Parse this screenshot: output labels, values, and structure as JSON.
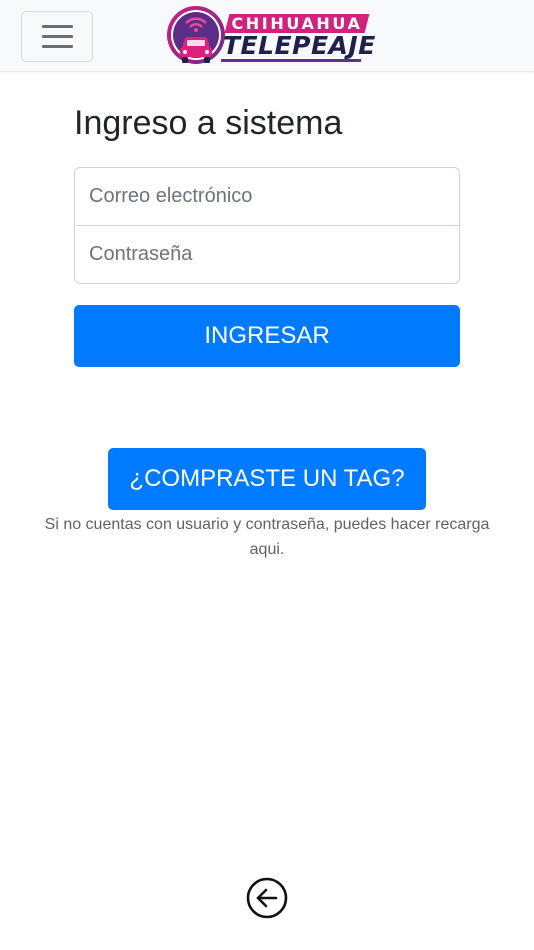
{
  "logo": {
    "line1": "CHIHUAHUA",
    "line2": "TELEPEAJE"
  },
  "login": {
    "title": "Ingreso a sistema",
    "email_placeholder": "Correo electrónico",
    "password_placeholder": "Contraseña",
    "submit_label": "INGRESAR"
  },
  "tag": {
    "button_label": "¿COMPRASTE UN TAG?",
    "help_text": "Si no cuentas con usuario y contraseña, puedes hacer recarga",
    "help_link": "aqui."
  },
  "icons": {
    "menu": "hamburger-icon",
    "back": "arrow-left-circle-icon",
    "logo": "car-signal-icon"
  },
  "colors": {
    "primary": "#007bff",
    "brand_pink": "#d1227f",
    "brand_navy": "#20204a",
    "brand_purple": "#6a2c8c"
  }
}
